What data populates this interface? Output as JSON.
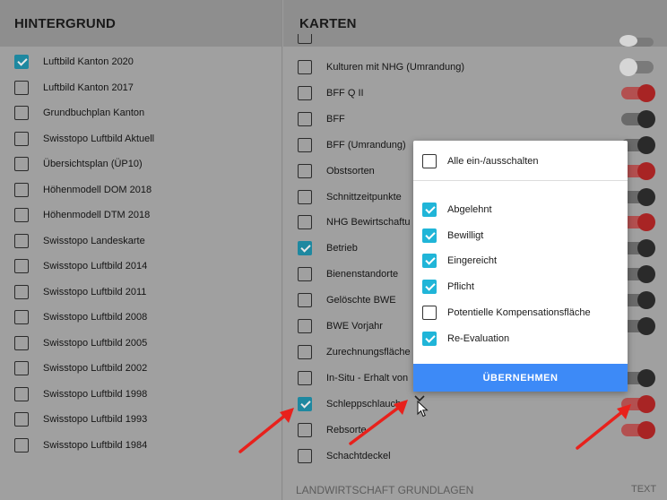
{
  "left": {
    "title": "HINTERGRUND",
    "items": [
      {
        "label": "Luftbild Kanton 2020",
        "checked": true
      },
      {
        "label": "Luftbild Kanton 2017",
        "checked": false
      },
      {
        "label": "Grundbuchplan Kanton",
        "checked": false
      },
      {
        "label": "Swisstopo Luftbild Aktuell",
        "checked": false
      },
      {
        "label": "Übersichtsplan (ÜP10)",
        "checked": false
      },
      {
        "label": "Höhenmodell DOM 2018",
        "checked": false
      },
      {
        "label": "Höhenmodell DTM 2018",
        "checked": false
      },
      {
        "label": "Swisstopo Landeskarte",
        "checked": false
      },
      {
        "label": "Swisstopo Luftbild 2014",
        "checked": false
      },
      {
        "label": "Swisstopo Luftbild 2011",
        "checked": false
      },
      {
        "label": "Swisstopo Luftbild 2008",
        "checked": false
      },
      {
        "label": "Swisstopo Luftbild 2005",
        "checked": false
      },
      {
        "label": "Swisstopo Luftbild 2002",
        "checked": false
      },
      {
        "label": "Swisstopo Luftbild 1998",
        "checked": false
      },
      {
        "label": "Swisstopo Luftbild 1993",
        "checked": false
      },
      {
        "label": "Swisstopo Luftbild 1984",
        "checked": false
      }
    ]
  },
  "right": {
    "title": "KARTEN",
    "items": [
      {
        "label": "Kulturen mit NHG (Umrandung)",
        "checked": false,
        "toggle": "off"
      },
      {
        "label": "BFF Q II",
        "checked": false,
        "toggle": "red"
      },
      {
        "label": "BFF",
        "checked": false,
        "toggle": "dark"
      },
      {
        "label": "BFF (Umrandung)",
        "checked": false,
        "toggle": "dark"
      },
      {
        "label": "Obstsorten",
        "checked": false,
        "toggle": "red"
      },
      {
        "label": "Schnittzeitpunkte",
        "checked": false,
        "toggle": "dark"
      },
      {
        "label": "NHG Bewirtschaftu",
        "checked": false,
        "toggle": "red"
      },
      {
        "label": "Betrieb",
        "checked": true,
        "toggle": "dark"
      },
      {
        "label": "Bienenstandorte",
        "checked": false,
        "toggle": "dark"
      },
      {
        "label": "Gelöschte BWE",
        "checked": false,
        "toggle": "dark"
      },
      {
        "label": "BWE Vorjahr",
        "checked": false,
        "toggle": "dark"
      },
      {
        "label": "Zurechnungsfläche",
        "checked": false,
        "toggle": "none"
      },
      {
        "label": "In-Situ - Erhalt von",
        "checked": false,
        "toggle": "dark"
      },
      {
        "label": "Schleppschlauch",
        "checked": true,
        "toggle": "red"
      },
      {
        "label": "Rebsorte",
        "checked": false,
        "toggle": "red"
      },
      {
        "label": "Schachtdeckel",
        "checked": false,
        "toggle": "none"
      }
    ],
    "section_footer": "LANDWIRTSCHAFT GRUNDLAGEN",
    "footer_right": "TEXT"
  },
  "popup": {
    "toggle_all_label": "Alle ein-/ausschalten",
    "options": [
      {
        "label": "Abgelehnt",
        "checked": true
      },
      {
        "label": "Bewilligt",
        "checked": true
      },
      {
        "label": "Eingereicht",
        "checked": true
      },
      {
        "label": "Pflicht",
        "checked": true
      },
      {
        "label": "Potentielle Kompensationsfläche",
        "checked": false
      },
      {
        "label": "Re-Evaluation",
        "checked": true
      }
    ],
    "apply_label": "ÜBERNEHMEN"
  },
  "colors": {
    "accent_blue": "#3d8af7",
    "checkbox_cyan": "#20b5d8",
    "toggle_red": "#a82424",
    "annotation_red": "#e8211c"
  }
}
